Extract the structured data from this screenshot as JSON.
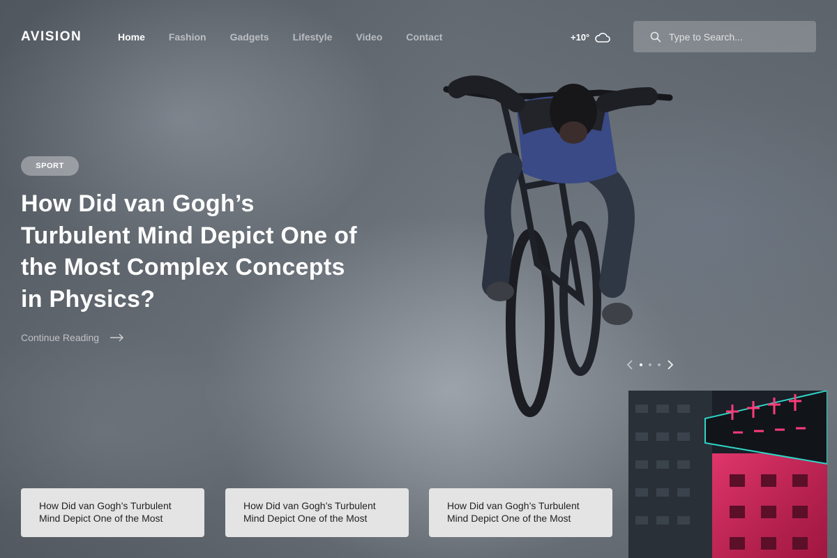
{
  "header": {
    "logo": "AVISION",
    "nav": [
      {
        "label": "Home",
        "active": true
      },
      {
        "label": "Fashion",
        "active": false
      },
      {
        "label": "Gadgets",
        "active": false
      },
      {
        "label": "Lifestyle",
        "active": false
      },
      {
        "label": "Video",
        "active": false
      },
      {
        "label": "Contact",
        "active": false
      }
    ],
    "weather": {
      "temperature": "+10°",
      "icon": "cloud-icon"
    },
    "search": {
      "placeholder": "Type to Search...",
      "value": "",
      "icon": "search-icon"
    }
  },
  "hero": {
    "category": "SPORT",
    "title": "How Did van Gogh’s Turbulent Mind Depict One of the Most Complex Concepts in Physics?",
    "cta": "Continue Reading",
    "cta_icon": "arrow-right-icon",
    "slider": {
      "current_slide": 1,
      "total_slides": 3
    }
  },
  "cards": [
    {
      "title": "How Did van Gogh’s Turbulent Mind Depict One of the Most"
    },
    {
      "title": "How Did van Gogh’s Turbulent Mind Depict One of the Most"
    },
    {
      "title": "How Did van Gogh’s Turbulent Mind Depict One of the Most"
    }
  ],
  "colors": {
    "card_bg": "#e4e4e4",
    "neon_pink": "#ff2f6d",
    "text": "#ffffff"
  }
}
